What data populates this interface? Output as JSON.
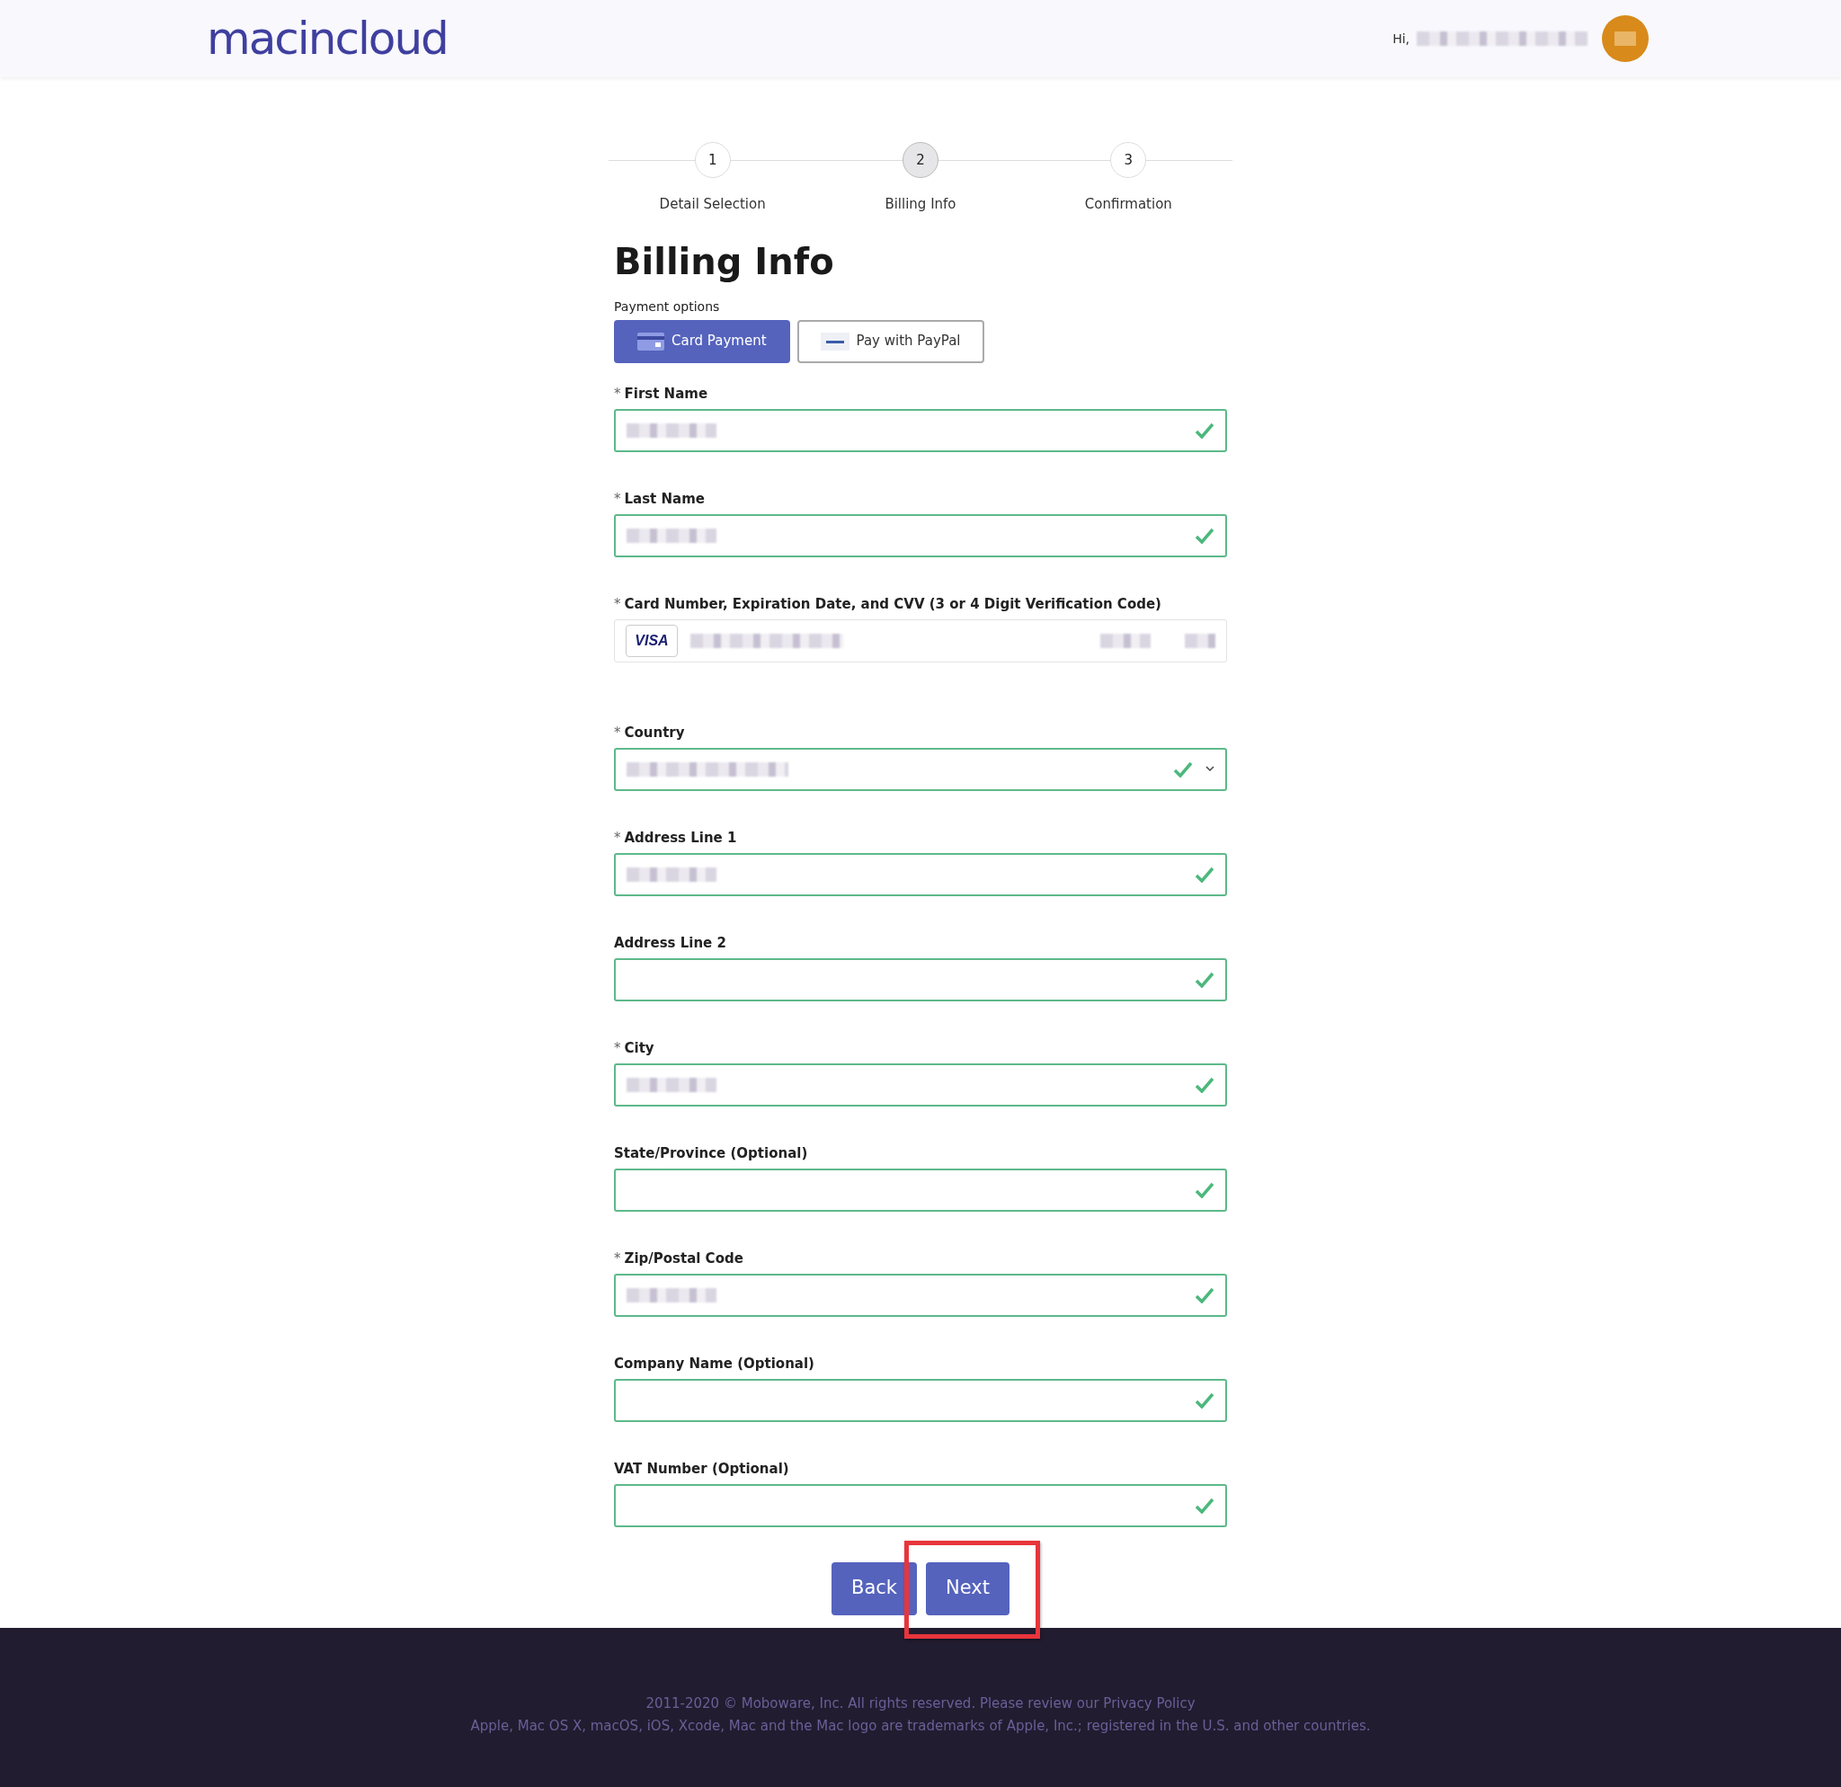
{
  "header": {
    "logo": "macincloud",
    "greeting": "Hi,",
    "user_name_blurred": true
  },
  "steps": [
    {
      "number": "1",
      "label": "Detail Selection",
      "selected": false
    },
    {
      "number": "2",
      "label": "Billing Info",
      "selected": true
    },
    {
      "number": "3",
      "label": "Confirmation",
      "selected": false
    }
  ],
  "heading": "Billing Info",
  "payment_options": {
    "label": "Payment options",
    "options": [
      {
        "kind": "card",
        "label": "Card Payment",
        "selected": true
      },
      {
        "kind": "paypal",
        "label": "Pay with PayPal",
        "selected": false
      }
    ]
  },
  "fields": [
    {
      "kind": "text",
      "mark": "*",
      "label": "First Name",
      "value_blurred": true,
      "valid": true
    },
    {
      "kind": "text",
      "mark": "*",
      "label": "Last Name",
      "value_blurred": true,
      "valid": true
    },
    {
      "kind": "card",
      "mark": "*",
      "label": "Card Number, Expiration Date, and CVV (3 or 4 Digit Verification Code)",
      "brand": "VISA",
      "value_blurred": true,
      "valid": false
    },
    {
      "kind": "select",
      "mark": "*",
      "label": "Country",
      "value_blurred": true,
      "valid": true
    },
    {
      "kind": "text",
      "mark": "*",
      "label": "Address Line 1",
      "value_blurred": true,
      "valid": true
    },
    {
      "kind": "text",
      "label": "Address Line 2",
      "value_blurred": false,
      "valid": true
    },
    {
      "kind": "text",
      "mark": "*",
      "label": "City",
      "value_blurred": true,
      "valid": true
    },
    {
      "kind": "text",
      "label": "State/Province (Optional)",
      "value_blurred": false,
      "valid": true
    },
    {
      "kind": "text",
      "mark": "*",
      "label": "Zip/Postal Code",
      "value_blurred": true,
      "valid": true
    },
    {
      "kind": "text",
      "label": "Company Name (Optional)",
      "value_blurred": false,
      "valid": true
    },
    {
      "kind": "text",
      "label": "VAT Number (Optional)",
      "value_blurred": false,
      "valid": true
    }
  ],
  "buttons": [
    {
      "label": "Back",
      "highlighted": false
    },
    {
      "label": "Next",
      "highlighted": true
    }
  ],
  "footer": {
    "copyright": "2011-2020 © Moboware, Inc. All rights reserved. Please review our",
    "link": "Privacy Policy",
    "trademark": "Apple, Mac OS X, macOS, iOS, Xcode, Mac and the Mac logo are trademarks of Apple, Inc.; registered in the U.S. and other countries."
  }
}
